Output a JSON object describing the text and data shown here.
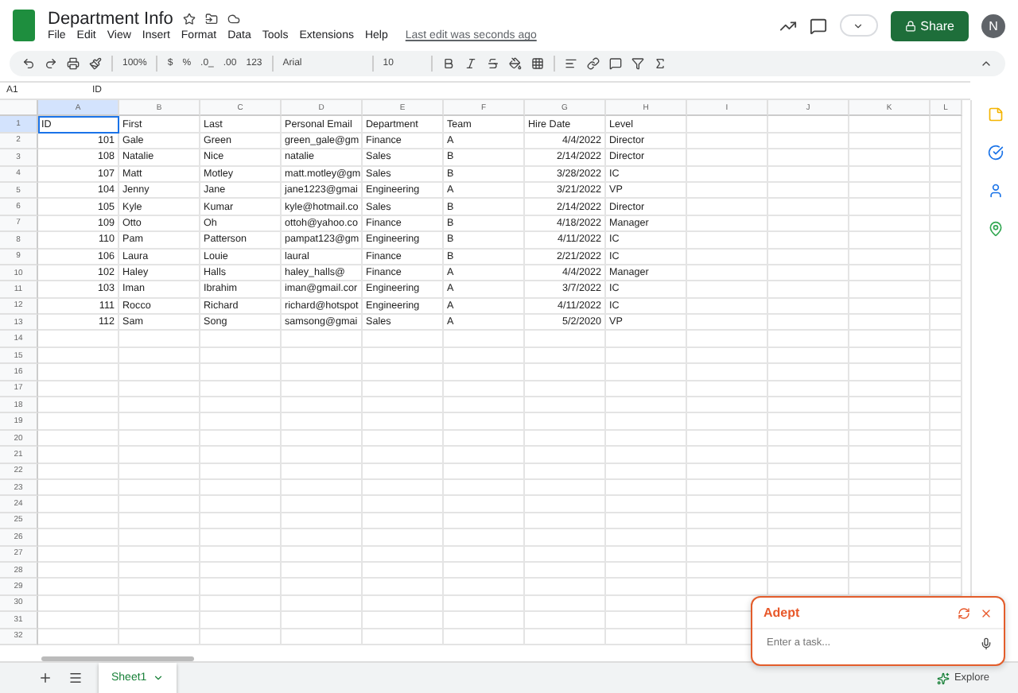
{
  "app": {
    "title": "Department Info",
    "menu": [
      "File",
      "Edit",
      "View",
      "Insert",
      "Format",
      "Data",
      "Tools",
      "Extensions",
      "Help"
    ],
    "last_edit": "Last edit was seconds ago",
    "share": "Share",
    "avatar": "N"
  },
  "toolbar": {
    "zoom": "100%",
    "currency": "$",
    "percent": "%",
    "decimal_decrease": ".0_",
    "decimal_increase": ".00",
    "number_format": "123",
    "font": "Arial",
    "font_size": "10"
  },
  "formula_bar": {
    "cell": "A1",
    "value": "ID"
  },
  "sheet": {
    "columns": [
      {
        "letter": "A",
        "selected": true
      },
      {
        "letter": "B",
        "selected": false
      },
      {
        "letter": "C",
        "selected": false
      },
      {
        "letter": "D",
        "selected": false
      },
      {
        "letter": "E",
        "selected": false
      },
      {
        "letter": "F",
        "selected": false
      },
      {
        "letter": "G",
        "selected": false
      },
      {
        "letter": "H",
        "selected": false
      },
      {
        "letter": "I",
        "selected": false
      },
      {
        "letter": "J",
        "selected": false
      },
      {
        "letter": "K",
        "selected": false
      },
      {
        "letter": "L",
        "selected": false
      }
    ],
    "rows": [
      {
        "number": "1",
        "selected": true,
        "cells": [
          "ID",
          "First",
          "Last",
          "Personal Email",
          "Department",
          "Team",
          "Hire Date",
          "Level"
        ]
      },
      {
        "number": "2",
        "selected": false,
        "cells": [
          "101",
          "Gale",
          "Green",
          "green_gale@gm",
          "Finance",
          "A",
          "4/4/2022",
          "Director"
        ]
      },
      {
        "number": "3",
        "selected": false,
        "cells": [
          "108",
          "Natalie",
          "Nice",
          "natalie",
          "Sales",
          "B",
          "2/14/2022",
          "Director"
        ]
      },
      {
        "number": "4",
        "selected": false,
        "cells": [
          "107",
          "Matt",
          "Motley",
          "matt.motley@gm",
          "Sales",
          "B",
          "3/28/2022",
          "IC"
        ]
      },
      {
        "number": "5",
        "selected": false,
        "cells": [
          "104",
          "Jenny",
          "Jane",
          "jane1223@gmai",
          "Engineering",
          "A",
          "3/21/2022",
          "VP"
        ]
      },
      {
        "number": "6",
        "selected": false,
        "cells": [
          "105",
          "Kyle",
          "Kumar",
          "kyle@hotmail.co",
          "Sales",
          "B",
          "2/14/2022",
          "Director"
        ]
      },
      {
        "number": "7",
        "selected": false,
        "cells": [
          "109",
          "Otto",
          "Oh",
          "ottoh@yahoo.co",
          "Finance",
          "B",
          "4/18/2022",
          "Manager"
        ]
      },
      {
        "number": "8",
        "selected": false,
        "cells": [
          "110",
          "Pam",
          "Patterson",
          "pampat123@gm",
          "Engineering",
          "B",
          "4/11/2022",
          "IC"
        ]
      },
      {
        "number": "9",
        "selected": false,
        "cells": [
          "106",
          "Laura",
          "Louie",
          "laural",
          "Finance",
          "B",
          "2/21/2022",
          "IC"
        ]
      },
      {
        "number": "10",
        "selected": false,
        "cells": [
          "102",
          "Haley",
          "Halls",
          "haley_halls@",
          "Finance",
          "A",
          "4/4/2022",
          "Manager"
        ]
      },
      {
        "number": "11",
        "selected": false,
        "cells": [
          "103",
          "Iman",
          "Ibrahim",
          "iman@gmail.cor",
          "Engineering",
          "A",
          "3/7/2022",
          "IC"
        ]
      },
      {
        "number": "12",
        "selected": false,
        "cells": [
          "111",
          "Rocco",
          "Richard",
          "richard@hotspot",
          "Engineering",
          "A",
          "4/11/2022",
          "IC"
        ]
      },
      {
        "number": "13",
        "selected": false,
        "cells": [
          "112",
          "Sam",
          "Song",
          "samsong@gmai",
          "Sales",
          "A",
          "5/2/2020",
          "VP"
        ]
      },
      {
        "number": "14",
        "selected": false,
        "cells": []
      },
      {
        "number": "15",
        "selected": false,
        "cells": []
      },
      {
        "number": "16",
        "selected": false,
        "cells": []
      },
      {
        "number": "17",
        "selected": false,
        "cells": []
      },
      {
        "number": "18",
        "selected": false,
        "cells": []
      },
      {
        "number": "19",
        "selected": false,
        "cells": []
      },
      {
        "number": "20",
        "selected": false,
        "cells": []
      },
      {
        "number": "21",
        "selected": false,
        "cells": []
      },
      {
        "number": "22",
        "selected": false,
        "cells": []
      },
      {
        "number": "23",
        "selected": false,
        "cells": []
      },
      {
        "number": "24",
        "selected": false,
        "cells": []
      },
      {
        "number": "25",
        "selected": false,
        "cells": []
      },
      {
        "number": "26",
        "selected": false,
        "cells": []
      },
      {
        "number": "27",
        "selected": false,
        "cells": []
      },
      {
        "number": "28",
        "selected": false,
        "cells": []
      },
      {
        "number": "29",
        "selected": false,
        "cells": []
      },
      {
        "number": "30",
        "selected": false,
        "cells": []
      },
      {
        "number": "31",
        "selected": false,
        "cells": []
      },
      {
        "number": "32",
        "selected": false,
        "cells": []
      }
    ]
  },
  "sheet_tabs": [
    {
      "label": "Sheet1",
      "selected": true
    }
  ],
  "explore": "Explore",
  "assistant": {
    "title": "Adept",
    "placeholder": "Enter a task..."
  }
}
